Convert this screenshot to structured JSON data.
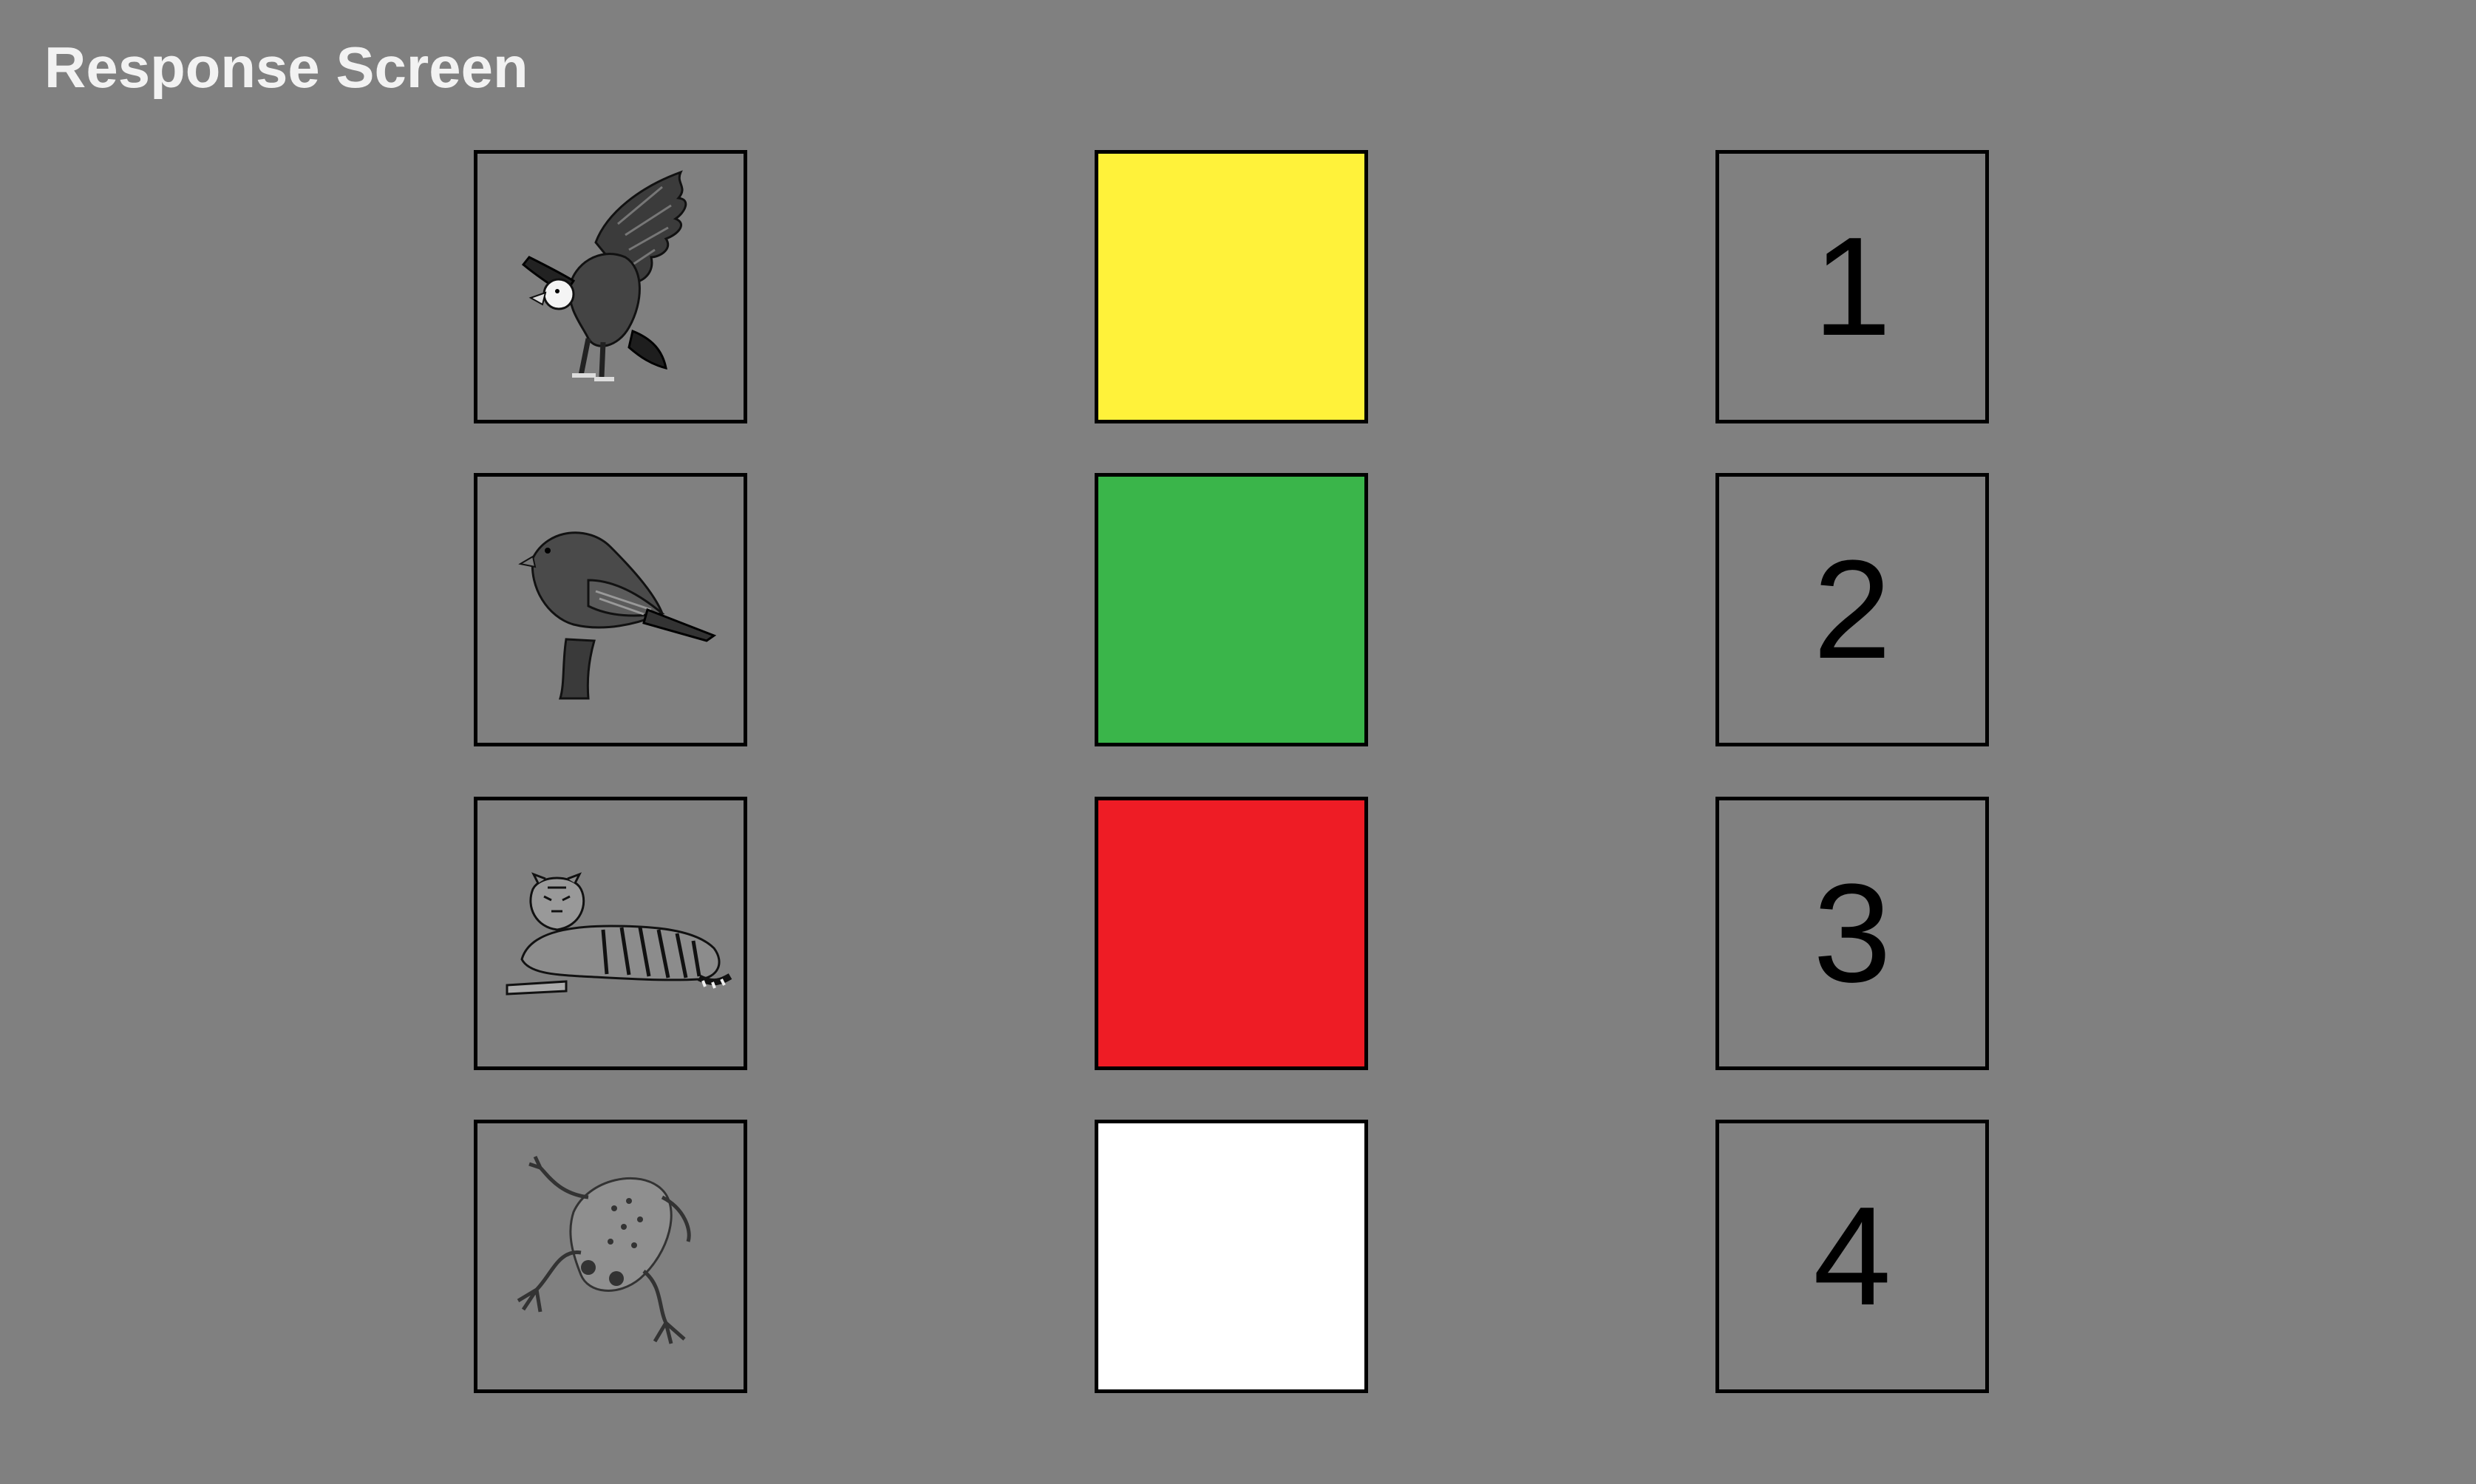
{
  "screen": {
    "title": "Response Screen",
    "background": "#808080"
  },
  "animal_options": [
    {
      "icon": "eagle-icon"
    },
    {
      "icon": "sparrow-icon"
    },
    {
      "icon": "tiger-icon"
    },
    {
      "icon": "frog-icon"
    }
  ],
  "color_options": [
    {
      "color": "#FFF23A"
    },
    {
      "color": "#3AB54A"
    },
    {
      "color": "#EE1C25"
    },
    {
      "color": "#FFFFFF"
    }
  ],
  "number_options": [
    {
      "label": "1"
    },
    {
      "label": "2"
    },
    {
      "label": "3"
    },
    {
      "label": "4"
    }
  ]
}
